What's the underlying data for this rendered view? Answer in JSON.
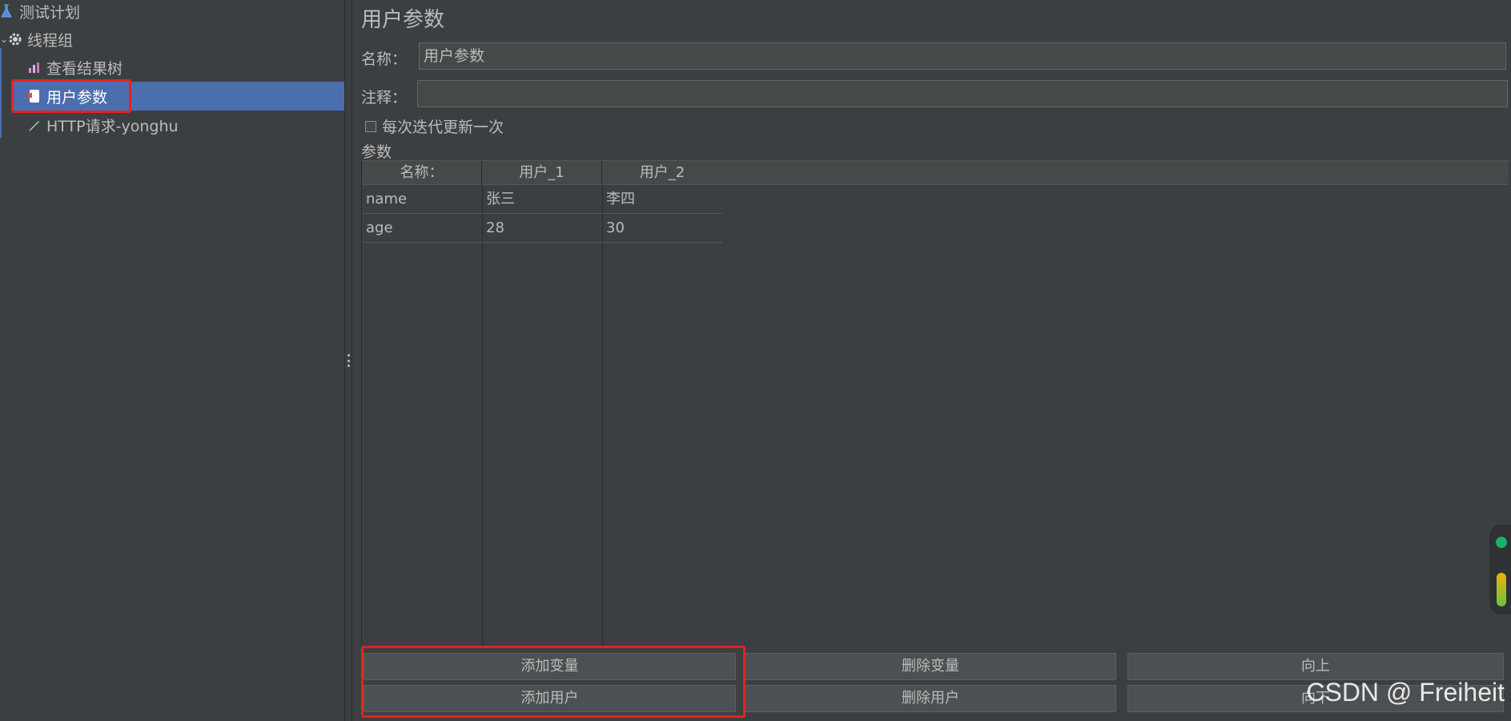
{
  "tree": {
    "items": [
      {
        "label": "测试计划",
        "icon": "flask-icon"
      },
      {
        "label": "线程组",
        "icon": "gear-icon"
      },
      {
        "label": "查看结果树",
        "icon": "chart-icon"
      },
      {
        "label": "用户参数",
        "icon": "document-icon"
      },
      {
        "label": "HTTP请求-yonghu",
        "icon": "pen-icon"
      }
    ],
    "selected_index": 3
  },
  "panel": {
    "title": "用户参数",
    "name_label": "名称：",
    "name_value": "用户参数",
    "comment_label": "注释：",
    "comment_value": "",
    "checkbox_label": "每次迭代更新一次",
    "checkbox_checked": false,
    "params_label": "参数"
  },
  "table": {
    "headers": [
      "名称：",
      "用户_1",
      "用户_2"
    ],
    "rows": [
      [
        "name",
        "张三",
        "李四"
      ],
      [
        "age",
        "28",
        "30"
      ]
    ]
  },
  "buttons": {
    "add_variable": "添加变量",
    "delete_variable": "删除变量",
    "move_up": "向上",
    "add_user": "添加用户",
    "delete_user": "删除用户",
    "move_down": "向下"
  },
  "watermark": "CSDN @ Freiheit",
  "colors": {
    "background": "#3c3f41",
    "selection": "#4b6eaf",
    "highlight": "#e82020"
  }
}
